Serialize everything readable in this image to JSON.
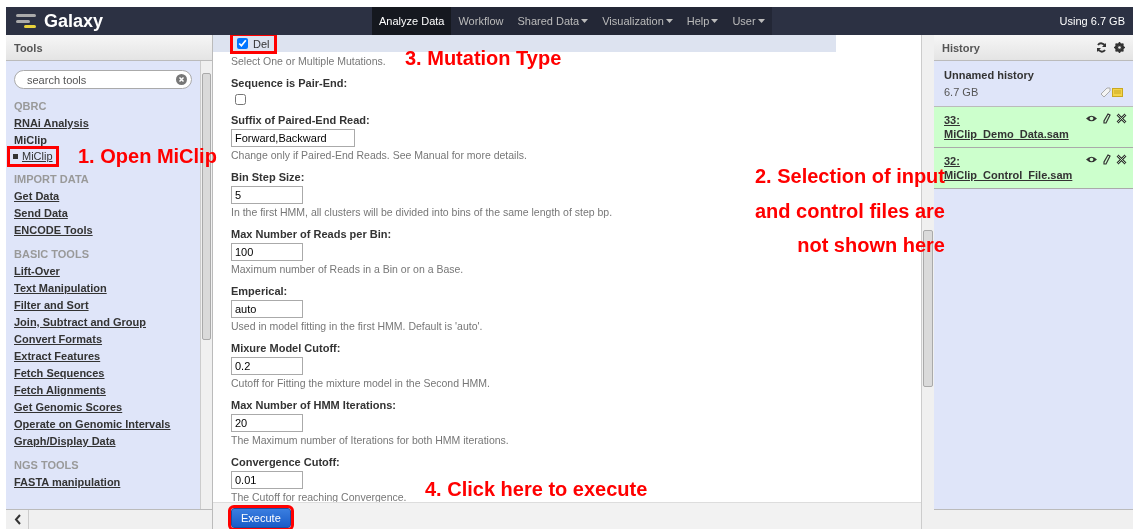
{
  "navbar": {
    "brand": "Galaxy",
    "menu": [
      {
        "label": "Analyze Data",
        "selected": true,
        "dropdown": false
      },
      {
        "label": "Workflow",
        "selected": false,
        "dropdown": false
      },
      {
        "label": "Shared Data",
        "selected": false,
        "dropdown": true
      },
      {
        "label": "Visualization",
        "selected": false,
        "dropdown": true
      },
      {
        "label": "Help",
        "selected": false,
        "dropdown": true
      },
      {
        "label": "User",
        "selected": false,
        "dropdown": true
      }
    ],
    "usage": "Using 6.7 GB"
  },
  "tools": {
    "title": "Tools",
    "search": {
      "placeholder": "search tools"
    },
    "sections": [
      {
        "title": "QBRC",
        "items": [
          {
            "label": "RNAi Analysis",
            "kind": "link",
            "highlighted": false
          },
          {
            "label": "MiClip",
            "kind": "heading",
            "highlighted": false
          },
          {
            "label": "MiClip",
            "kind": "tool",
            "highlighted": true
          }
        ]
      },
      {
        "title": "IMPORT DATA",
        "items": [
          {
            "label": "Get Data",
            "kind": "link",
            "highlighted": false
          },
          {
            "label": "Send Data",
            "kind": "link",
            "highlighted": false
          },
          {
            "label": "ENCODE Tools",
            "kind": "link",
            "highlighted": false
          }
        ]
      },
      {
        "title": "BASIC TOOLS",
        "items": [
          {
            "label": "Lift-Over",
            "kind": "link",
            "highlighted": false
          },
          {
            "label": "Text Manipulation",
            "kind": "link",
            "highlighted": false
          },
          {
            "label": "Filter and Sort",
            "kind": "link",
            "highlighted": false
          },
          {
            "label": "Join, Subtract and Group",
            "kind": "link",
            "highlighted": false
          },
          {
            "label": "Convert Formats",
            "kind": "link",
            "highlighted": false
          },
          {
            "label": "Extract Features",
            "kind": "link",
            "highlighted": false
          },
          {
            "label": "Fetch Sequences",
            "kind": "link",
            "highlighted": false
          },
          {
            "label": "Fetch Alignments",
            "kind": "link",
            "highlighted": false
          },
          {
            "label": "Get Genomic Scores",
            "kind": "link",
            "highlighted": false
          },
          {
            "label": "Operate on Genomic Intervals",
            "kind": "link",
            "highlighted": false
          },
          {
            "label": "Graph/Display Data",
            "kind": "link",
            "highlighted": false
          }
        ]
      },
      {
        "title": "NGS TOOLS",
        "items": [
          {
            "label": "FASTA manipulation",
            "kind": "link",
            "highlighted": false
          }
        ]
      }
    ]
  },
  "form": {
    "mutation": {
      "label": "Del",
      "checked": true,
      "highlighted": true
    },
    "mutation_hint": "Select One or Multiple Mutations.",
    "fields": [
      {
        "kind": "checkbox",
        "label": "Sequence is Pair-End:",
        "checked": false
      },
      {
        "kind": "text",
        "label": "Suffix of Paired-End Read:",
        "value": "Forward,Backward",
        "hint": "Change only if Paired-End Reads. See Manual for more details."
      },
      {
        "kind": "text",
        "label": "Bin Step Size:",
        "value": "5",
        "hint": "In the first HMM, all clusters will be divided into bins of the same length of step bp."
      },
      {
        "kind": "text",
        "label": "Max Number of Reads per Bin:",
        "value": "100",
        "hint": "Maximum number of Reads in a Bin or on a Base."
      },
      {
        "kind": "text",
        "label": "Emperical:",
        "value": "auto",
        "hint": "Used in model fitting in the first HMM. Default is 'auto'."
      },
      {
        "kind": "text",
        "label": "Mixure Model Cutoff:",
        "value": "0.2",
        "hint": "Cutoff for Fitting the mixture model in the Second HMM."
      },
      {
        "kind": "text",
        "label": "Max Number of HMM Iterations:",
        "value": "20",
        "hint": "The Maximum number of Iterations for both HMM iterations."
      },
      {
        "kind": "text",
        "label": "Convergence Cutoff:",
        "value": "0.01",
        "hint": "The Cutoff for reaching Convergence."
      }
    ],
    "execute": {
      "label": "Execute",
      "highlighted": true
    }
  },
  "history": {
    "title": "History",
    "name": "Unnamed history",
    "size": "6.7 GB",
    "datasets": [
      {
        "hid": "33:",
        "name": "MiClip_Demo_Data.sam"
      },
      {
        "hid": "32:",
        "name": "MiClip_Control_File.sam"
      }
    ]
  },
  "annotations": [
    "1. Open MiClip",
    "2. Selection of input\nand control files are\nnot shown here",
    "3. Mutation Type",
    "4. Click here to execute"
  ]
}
